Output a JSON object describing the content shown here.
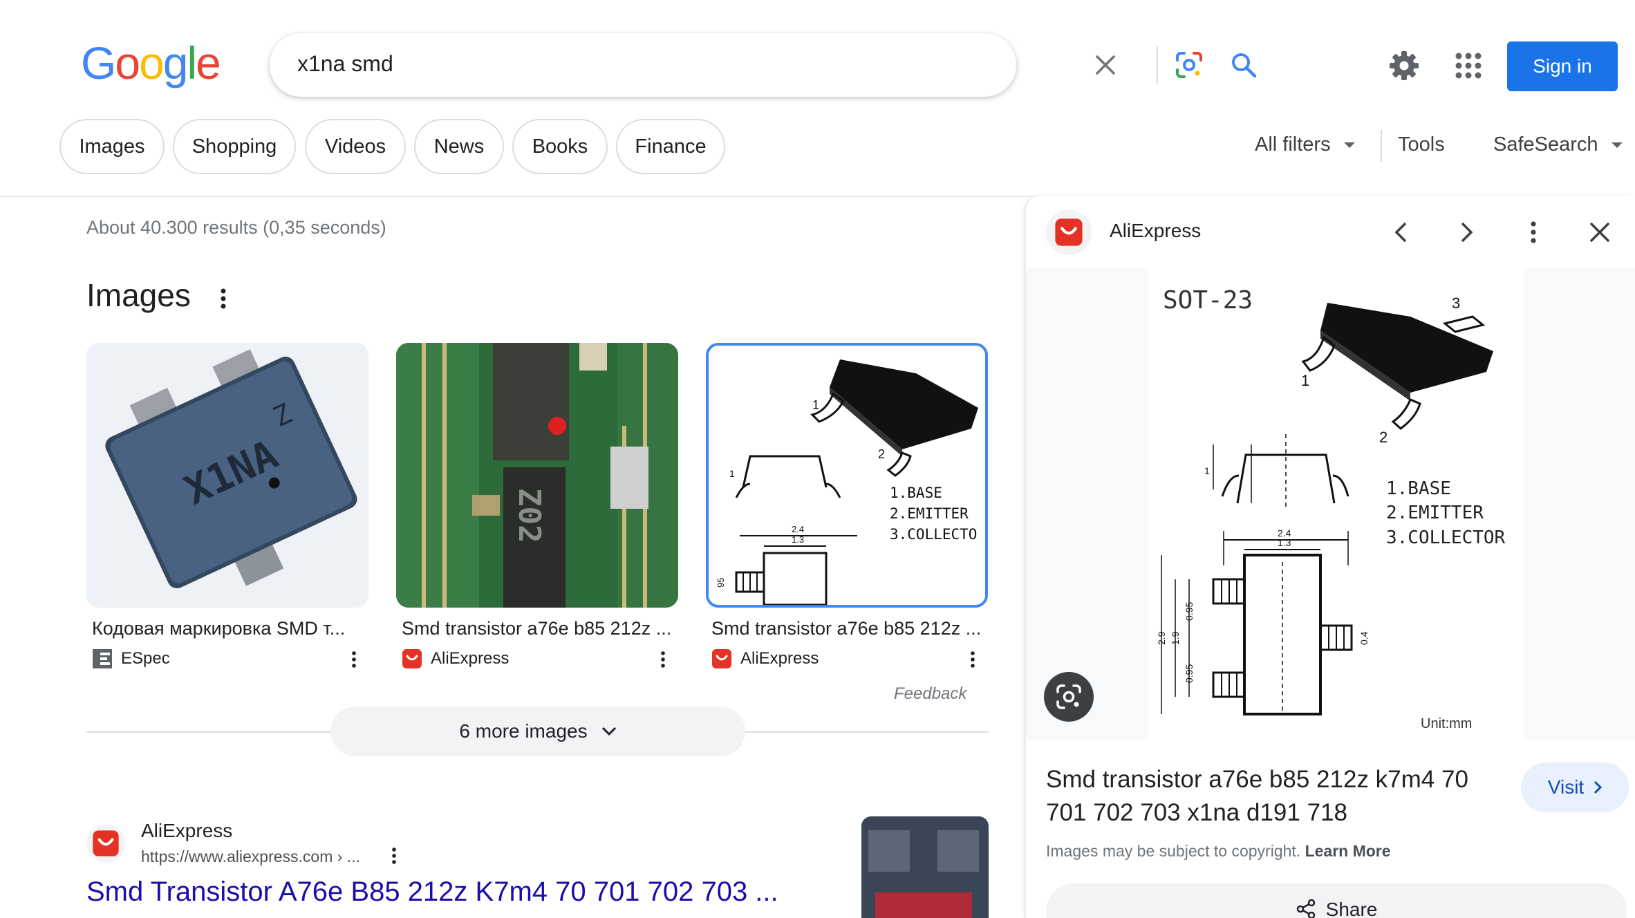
{
  "header": {
    "logo_letters": [
      "G",
      "o",
      "o",
      "g",
      "l",
      "e"
    ],
    "query": "x1na smd",
    "sign_in": "Sign in"
  },
  "chips": [
    "Images",
    "Shopping",
    "Videos",
    "News",
    "Books",
    "Finance"
  ],
  "toolbar": {
    "all_filters": "All filters",
    "tools": "Tools",
    "safesearch": "SafeSearch"
  },
  "results": {
    "stats": "About 40.300 results (0,35 seconds)",
    "images_heading": "Images",
    "thumbnails": [
      {
        "title": "Кодовая маркировка SMD т...",
        "source": "ESpec"
      },
      {
        "title": "Smd transistor a76e b85 212z ...",
        "source": "AliExpress"
      },
      {
        "title": "Smd transistor a76e b85 212z ...",
        "source": "AliExpress"
      }
    ],
    "feedback": "Feedback",
    "more_images": "6 more images",
    "first_result": {
      "site": "AliExpress",
      "url": "https://www.aliexpress.com › ...",
      "title": "Smd Transistor A76e B85 212z K7m4 70 701 702 703 ..."
    }
  },
  "panel": {
    "site": "AliExpress",
    "title": "Smd transistor a76e b85 212z k7m4 70 701 702 703 x1na d191 718",
    "visit": "Visit",
    "copyright": "Images may be subject to copyright.",
    "learn_more": "Learn More",
    "share": "Share",
    "diagram": {
      "package": "SOT-23",
      "pin1": "1",
      "pin2": "2",
      "pin3": "3",
      "legend": [
        "1.BASE",
        "2.EMITTER",
        "3.COLLECTOR"
      ],
      "dims_top": [
        "2.4",
        "1.3"
      ],
      "dims_left": [
        "2.9",
        "1.9",
        "0.95",
        "0.95"
      ],
      "dim_right": "0.4",
      "dim_side": "1",
      "unit": "Unit:mm"
    }
  },
  "thumb_diagram": {
    "pin1": "1",
    "pin2": "2",
    "legend": [
      "1.BASE",
      "2.EMITTER",
      "3.COLLECTO"
    ],
    "dims_top": [
      "2.4",
      "1.3"
    ],
    "dim_left": "95",
    "dim_side": "1"
  },
  "thumb_marking": {
    "chip1_text": "X1NA",
    "chip1_sub": "Z",
    "chip2_text": "Z02"
  },
  "colors": {
    "accent": "#1a73e8",
    "link": "#1a0dab",
    "aliexpress": "#e43225"
  }
}
